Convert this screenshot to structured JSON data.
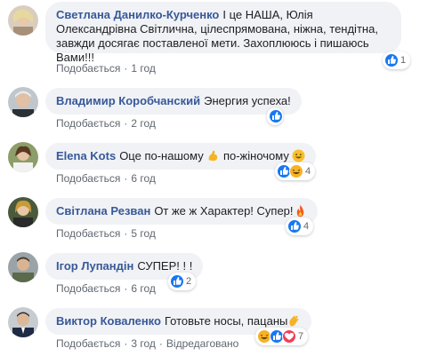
{
  "comments": [
    {
      "author": "Светлана Данилко-Курченко",
      "text": "І це НАША, Юлія Олександрівна Світлична, цілеспрямована, ніжна, тендітна, завжди досягає поставленої мети. Захоплююсь і пишаюсь Вами!!!",
      "like_label": "Подобається",
      "time": "1 год",
      "reactions": [
        "like"
      ],
      "reaction_count": "1"
    },
    {
      "author": "Владимир Коробчанский",
      "text": "Энергия успеха!",
      "like_label": "Подобається",
      "time": "2 год",
      "reactions": [
        "like"
      ],
      "reaction_count": ""
    },
    {
      "author": "Elena Kots",
      "text_before": "Оце по-нашому",
      "text_middle": "по-жіночому",
      "like_label": "Подобається",
      "time": "6 год",
      "reactions": [
        "like",
        "laugh"
      ],
      "reaction_count": "4"
    },
    {
      "author": "Світлана Резван",
      "text": "От же ж Характер! Супер!",
      "like_label": "Подобається",
      "time": "5 год",
      "reactions": [
        "like"
      ],
      "reaction_count": "4"
    },
    {
      "author": "Ігор Лупандін",
      "text": "СУПЕР! ! !",
      "like_label": "Подобається",
      "time": "6 год",
      "reactions": [
        "like"
      ],
      "reaction_count": "2"
    },
    {
      "author": "Виктор Коваленко",
      "text": "Готовьте носы, пацаны",
      "like_label": "Подобається",
      "time": "3 год",
      "edited": "Відредаговано",
      "reactions": [
        "laugh",
        "like",
        "love"
      ],
      "reaction_count": "7"
    }
  ],
  "colors": {
    "author": "#385898",
    "bubble": "#f0f2f5",
    "meta": "#606770",
    "like_blue": "#1877f2",
    "love_red": "#f33e58",
    "haha_yellow": "#f7b125"
  },
  "icons": [
    "thumbs-up-icon",
    "laugh-icon",
    "heart-icon",
    "flexed-biceps-icon",
    "fire-icon",
    "grin-icon",
    "clap-hands-icon"
  ]
}
